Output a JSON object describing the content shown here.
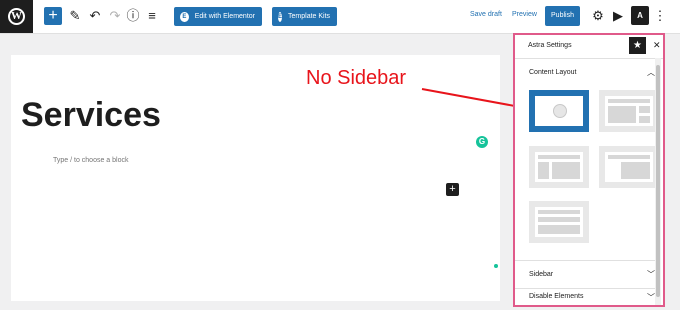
{
  "toolbar": {
    "edit_elementor_label": "Edit with Elementor",
    "template_kits_label": "Template Kits",
    "save_draft_label": "Save draft",
    "preview_label": "Preview",
    "publish_label": "Publish",
    "astra_badge": "A"
  },
  "editor": {
    "post_title": "Services",
    "block_placeholder": "Type / to choose a block"
  },
  "annotation": {
    "text": "No Sidebar",
    "color": "#e8141b"
  },
  "astra_panel": {
    "title": "Astra Settings",
    "sections": {
      "content_layout": "Content Layout",
      "sidebar": "Sidebar",
      "disable_elements": "Disable Elements"
    },
    "layout_options": [
      {
        "name": "no-sidebar",
        "selected": true
      },
      {
        "name": "right-sidebar",
        "selected": false
      },
      {
        "name": "left-sidebar",
        "selected": false
      },
      {
        "name": "narrow-sidebar",
        "selected": false
      },
      {
        "name": "full-width",
        "selected": false
      }
    ]
  },
  "colors": {
    "accent": "#2271b1",
    "highlight_border": "#e05a8a",
    "grammarly": "#15c39a"
  },
  "icons": [
    "wordpress-icon",
    "plus-icon",
    "pen-icon",
    "undo-icon",
    "redo-icon",
    "info-icon",
    "list-view-icon",
    "elementor-icon",
    "template-kits-icon",
    "settings-gear-icon",
    "jetpack-icon",
    "astra-icon",
    "more-vertical-icon",
    "star-icon",
    "close-icon",
    "chevron-up-icon",
    "chevron-down-icon",
    "grammarly-icon"
  ]
}
